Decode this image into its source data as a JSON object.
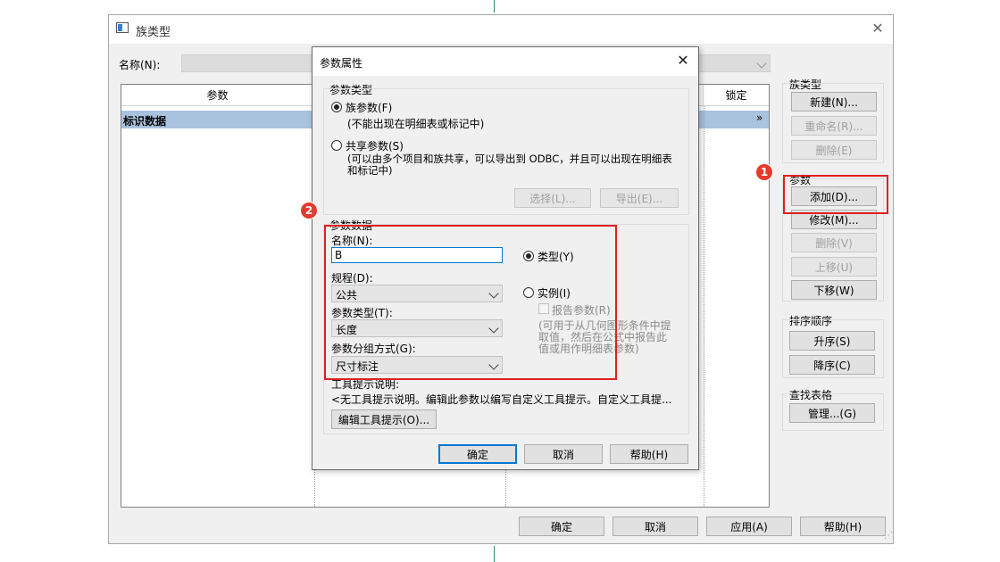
{
  "window": {
    "title": "族类型"
  },
  "name_row": {
    "label": "名称(N):",
    "value": ""
  },
  "table": {
    "headers": [
      "参数",
      "",
      "",
      "锁定"
    ],
    "selected_row": "标识数据",
    "row_chevron": "»"
  },
  "family_types": {
    "label": "族类型",
    "new": "新建(N)...",
    "rename": "重命名(R)...",
    "delete": "删除(E)"
  },
  "parameters": {
    "label": "参数",
    "add": "添加(D)...",
    "modify": "修改(M)...",
    "delete": "删除(V)",
    "move_up": "上移(U)",
    "move_down": "下移(W)"
  },
  "sort_order": {
    "label": "排序顺序",
    "asc": "升序(S)",
    "desc": "降序(C)"
  },
  "lookup": {
    "label": "查找表格",
    "manage": "管理...(G)"
  },
  "bottom_buttons": {
    "ok": "确定",
    "cancel": "取消",
    "apply": "应用(A)",
    "help": "帮助(H)"
  },
  "dialog": {
    "title": "参数属性",
    "param_type_group": "参数类型",
    "family_param": "族参数(F)",
    "family_param_desc": "(不能出现在明细表或标记中)",
    "shared_param": "共享参数(S)",
    "shared_param_desc_1": "(可以由多个项目和族共享，可以导出到 ODBC，并且可以出现在明细表",
    "shared_param_desc_2": "和标记中)",
    "select_btn": "选择(L)...",
    "export_btn": "导出(E)...",
    "param_data_group": "参数数据",
    "name_label": "名称(N):",
    "name_value": "B",
    "discipline_label": "规程(D):",
    "discipline_value": "公共",
    "ptype_label": "参数类型(T):",
    "ptype_value": "长度",
    "group_label": "参数分组方式(G):",
    "group_value": "尺寸标注",
    "type_radio": "类型(Y)",
    "instance_radio": "实例(I)",
    "report_param": "报告参数(R)",
    "report_desc_1": "(可用于从几何图形条件中提",
    "report_desc_2": "取值，然后在公式中报告此",
    "report_desc_3": "值或用作明细表参数)",
    "tooltip_label": "工具提示说明:",
    "tooltip_text": "<无工具提示说明。编辑此参数以编写自定义工具提示。自定义工具提...",
    "edit_tooltip": "编辑工具提示(O)...",
    "ok": "确定",
    "cancel": "取消",
    "help": "帮助(H)"
  },
  "annotations": {
    "badge1": "1",
    "badge2": "2"
  },
  "colors": {
    "accent": "#0078d7",
    "highlight": "#e02020",
    "selected_row": "#a9c3de"
  }
}
